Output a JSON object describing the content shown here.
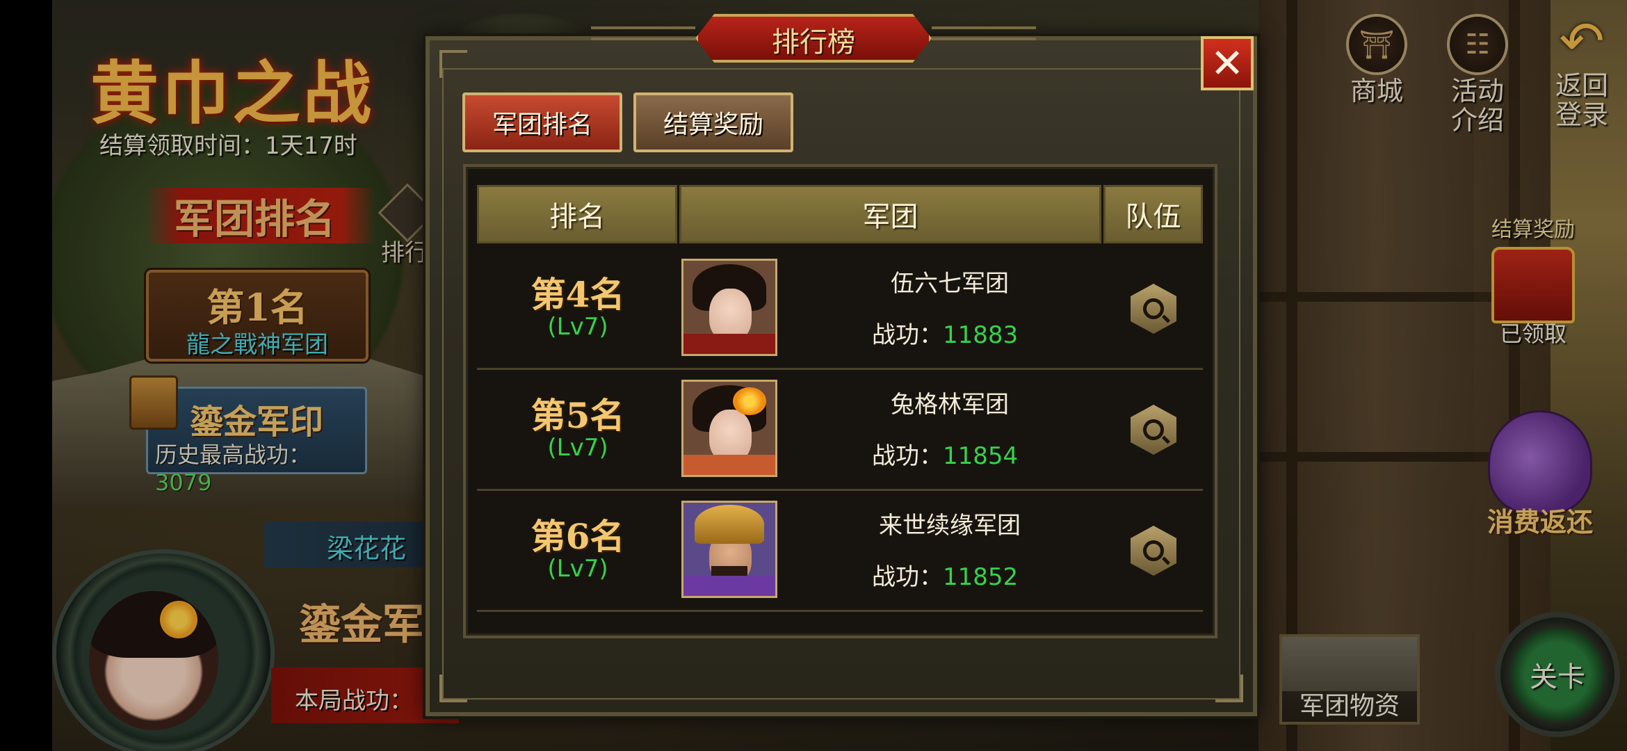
{
  "event": {
    "title": "黄巾之战",
    "claim_time": "结算领取时间：1天17时",
    "legion_rank_banner": "军团排名",
    "side_tab_label": "排行",
    "top_rank": {
      "label": "第1名",
      "legion": "龍之戰神军团"
    },
    "seal": {
      "title": "鎏金军印",
      "history_label": "历史最高战功：",
      "history_value": "3079"
    },
    "player_name": "梁花花",
    "seal_bottom": "鎏金军",
    "battle_merit_label": "本局战功："
  },
  "top_buttons": [
    {
      "label": "商城",
      "icon": "shop-icon"
    },
    {
      "label": "活动\n介绍",
      "icon": "event-info-icon"
    },
    {
      "label": "返回\n登录",
      "icon": "back-arrow-icon"
    }
  ],
  "right_widgets": {
    "reward_title": "结算奖励",
    "reward_status": "已领取",
    "refund_label": "消费返还",
    "supplies_label": "军团物资",
    "stage_label": "关卡"
  },
  "modal": {
    "title": "排行榜",
    "close_label": "✕",
    "tabs": [
      {
        "label": "军团排名",
        "active": true
      },
      {
        "label": "结算奖励",
        "active": false
      }
    ],
    "columns": [
      "排名",
      "军团",
      "队伍"
    ],
    "merit_label": "战功：",
    "rows": [
      {
        "rank": "第4名",
        "level": "(Lv7)",
        "legion": "伍六七军团",
        "merit": "11883",
        "portrait": "female-general-portrait"
      },
      {
        "rank": "第5名",
        "level": "(Lv7)",
        "legion": "兔格林军团",
        "merit": "11854",
        "portrait": "flower-maiden-portrait"
      },
      {
        "rank": "第6名",
        "level": "(Lv7)",
        "legion": "来世续缘军团",
        "merit": "11852",
        "portrait": "armored-warrior-portrait"
      }
    ]
  },
  "colors": {
    "merit_value": "#38d24c",
    "level": "#35d24a",
    "rank_gold": "#f3c770",
    "modal_title_red": "#b8241a",
    "active_tab": "#c84a30"
  }
}
